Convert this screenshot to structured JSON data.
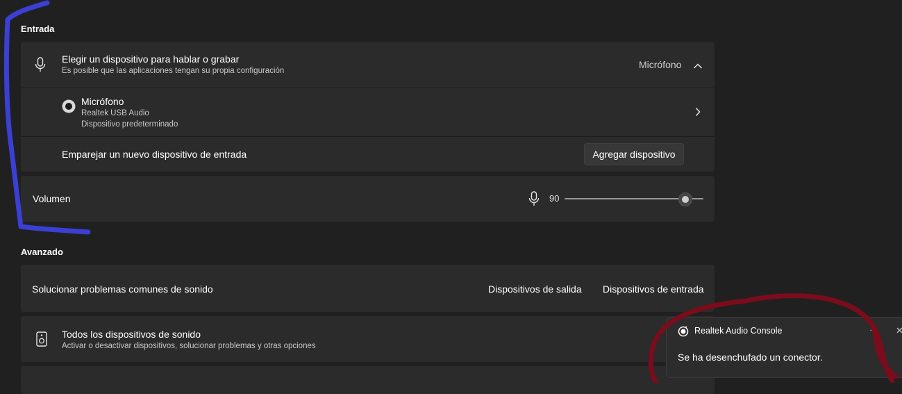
{
  "input_section": {
    "title": "Entrada",
    "device_chooser": {
      "title": "Elegir un dispositivo para hablar o grabar",
      "subtitle": "Es posible que las aplicaciones tengan su propia configuración",
      "selected_value": "Micrófono",
      "icon": "microphone-icon"
    },
    "device": {
      "name": "Micrófono",
      "detail": "Realtek USB Audio",
      "status": "Dispositivo predeterminado"
    },
    "pair": {
      "title": "Emparejar un nuevo dispositivo de entrada",
      "button": "Agregar dispositivo"
    },
    "volume": {
      "label": "Volumen",
      "value": "90",
      "level_percent": 90
    }
  },
  "advanced_section": {
    "title": "Avanzado",
    "troubleshoot": {
      "title": "Solucionar problemas comunes de sonido",
      "output_link": "Dispositivos de salida",
      "input_link": "Dispositivos de entrada"
    },
    "all_devices": {
      "title": "Todos los dispositivos de sonido",
      "subtitle": "Activar o desactivar dispositivos, solucionar problemas y otras opciones",
      "icon": "speaker-icon"
    }
  },
  "toast": {
    "app_name": "Realtek Audio Console",
    "message": "Se ha desenchufado un conector.",
    "more_label": "···",
    "close_label": "✕"
  },
  "colors": {
    "background": "#202020",
    "card": "#2b2b2b",
    "annotation_blue": "#3b3fd4",
    "annotation_red": "#7a0c1c"
  }
}
